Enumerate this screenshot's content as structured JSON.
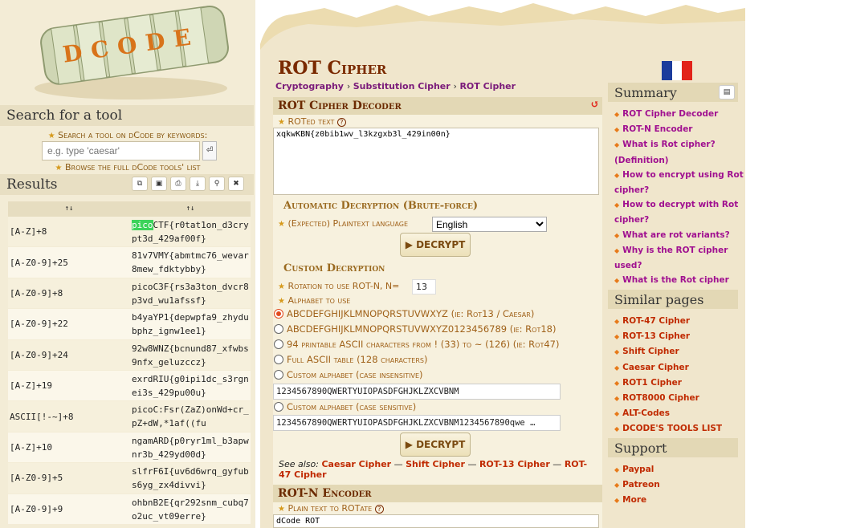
{
  "logo_text": "DCODE",
  "sidebar": {
    "search_heading": "Search for a tool",
    "search_label": "Search a tool on dCode by keywords:",
    "search_placeholder": "e.g. type 'caesar'",
    "browse_label": "Browse the full dCode tools' list",
    "results_heading": "Results",
    "sort_col1": "↑↓",
    "sort_col2": "↑↓"
  },
  "results": [
    {
      "key": "[A-Z]+8",
      "hl": "pico",
      "text": "CTF{r0tat1on_d3crypt3d_429af00f}"
    },
    {
      "key": "[A-Z0-9]+25",
      "hl": "",
      "text": "81v7VMY{abmtmc76_wevar8mew_fdktybby}"
    },
    {
      "key": "[A-Z0-9]+8",
      "hl": "",
      "text": "picoC3F{rs3a3ton_dvcr8p3vd_wu1afssf}"
    },
    {
      "key": "[A-Z0-9]+22",
      "hl": "",
      "text": "b4yaYP1{depwpfa9_zhydubphz_ignw1ee1}"
    },
    {
      "key": "[A-Z0-9]+24",
      "hl": "",
      "text": "92w8WNZ{bcnund87_xfwbs9nfx_geluzccz}"
    },
    {
      "key": "[A-Z]+19",
      "hl": "",
      "text": "exrdRIU{g0ipi1dc_s3rgnei3s_429pu00u}"
    },
    {
      "key": "ASCII[!-~]+8",
      "hl": "",
      "text": "picoC:Fsr(ZaZ)onWd+cr_pZ+dW,*1af((fu"
    },
    {
      "key": "[A-Z]+10",
      "hl": "",
      "text": "ngamARD{p0ryr1ml_b3apwnr3b_429yd00d}"
    },
    {
      "key": "[A-Z0-9]+5",
      "hl": "",
      "text": "slfrF6I{uv6d6wrq_gyfubs6yg_zx4divvi}"
    },
    {
      "key": "[A-Z0-9]+9",
      "hl": "",
      "text": "ohbnB2E{qr292snm_cubq7o2uc_vt09erre}"
    }
  ],
  "page": {
    "title": "ROT Cipher",
    "breadcrumb": [
      "Cryptography",
      "Substitution Cipher",
      "ROT Cipher"
    ],
    "decoder_heading": "ROT Cipher Decoder",
    "rot_text_label": "ROTed text",
    "rot_text_value": "xqkwKBN{z0bib1wv_l3kzgxb3l_429in00n}",
    "auto_heading": "Automatic Decryption (Brute-force)",
    "lang_label": "(Expected) Plaintext language",
    "lang_value": "English",
    "decrypt_label": "▶ DECRYPT",
    "custom_heading": "Custom Decryption",
    "rotation_label": "Rotation to use ROT-N, N=",
    "rotation_value": "13",
    "alphabet_label": "Alphabet to use",
    "options": [
      "ABCDEFGHIJKLMNOPQRSTUVWXYZ (ie: Rot13 / Caesar)",
      "ABCDEFGHIJKLMNOPQRSTUVWXYZ0123456789 (ie: Rot18)",
      "94 printable ASCII characters from ! (33) to ~ (126) (ie: Rot47)",
      "Full ASCII table (128 characters)",
      "Custom alphabet (case insensitive)",
      "Custom alphabet (case sensitive)"
    ],
    "custom_alpha1": "1234567890QWERTYUIOPASDFGHJKLZXCVBNM",
    "custom_alpha2": "1234567890QWERTYUIOPASDFGHJKLZXCVBNM1234567890qwe …",
    "see_also_label": "See also:",
    "see_also": [
      "Caesar Cipher",
      "Shift Cipher",
      "ROT-13 Cipher",
      "ROT-47 Cipher"
    ],
    "encoder_heading": "ROT-N Encoder",
    "plain_label": "Plain text to ROTate",
    "plain_value": "dCode ROT"
  },
  "summary": {
    "heading": "Summary",
    "items": [
      "ROT Cipher Decoder",
      "ROT-N Encoder",
      "What is Rot cipher? (Definition)",
      "How to encrypt using Rot cipher?",
      "How to decrypt with Rot cipher?",
      "What are rot variants?",
      "Why is the ROT cipher used?",
      "What is the Rot cipher algorithm?"
    ]
  },
  "similar": {
    "heading": "Similar pages",
    "items": [
      "ROT-47 Cipher",
      "ROT-13 Cipher",
      "Shift Cipher",
      "Caesar Cipher",
      "ROT1 Cipher",
      "ROT8000 Cipher",
      "ALT-Codes",
      "DCODE'S TOOLS LIST"
    ]
  },
  "support": {
    "heading": "Support",
    "items": [
      "Paypal",
      "Patreon",
      "More"
    ]
  },
  "colors": {
    "accent": "#7a2a00",
    "link": "#c02a00",
    "summary_link": "#a01090",
    "highlight": "#3cd35a"
  }
}
